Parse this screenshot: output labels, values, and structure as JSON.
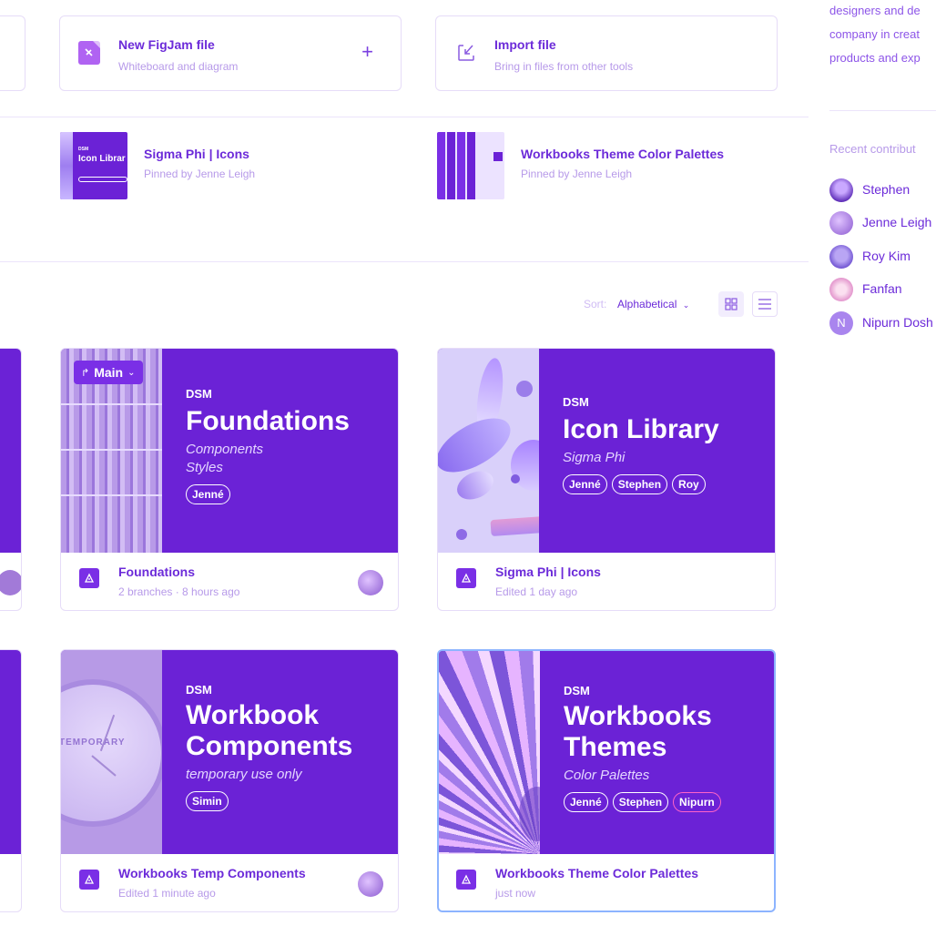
{
  "create": {
    "figjam": {
      "title": "New FigJam file",
      "subtitle": "Whiteboard and diagram",
      "action": "+"
    },
    "import": {
      "title": "Import file",
      "subtitle": "Bring in files from other tools"
    }
  },
  "pinned": [
    {
      "title": "Sigma Phi | Icons",
      "subtitle": "Pinned by Jenne Leigh",
      "thumb_label": "Icon Librar"
    },
    {
      "title": "Workbooks Theme Color Palettes",
      "subtitle": "Pinned by Jenne Leigh"
    }
  ],
  "sort": {
    "label": "Sort:",
    "value": "Alphabetical"
  },
  "files": [
    {
      "branch_label": "Main",
      "eyebrow": "DSM",
      "title_lines": [
        "Foundations"
      ],
      "subtitle_lines": [
        "Components",
        "Styles"
      ],
      "chips": [
        "Jenné"
      ],
      "name": "Foundations",
      "meta": "2 branches · 8 hours ago"
    },
    {
      "eyebrow": "DSM",
      "title_lines": [
        "Icon Library"
      ],
      "subtitle_lines": [
        "Sigma Phi"
      ],
      "chips": [
        "Jenné",
        "Stephen",
        "Roy"
      ],
      "name": "Sigma Phi | Icons",
      "meta": "Edited 1 day ago"
    },
    {
      "eyebrow": "DSM",
      "title_lines": [
        "Workbook",
        "Components"
      ],
      "subtitle_lines": [
        "temporary use only"
      ],
      "chips": [
        "Simin"
      ],
      "name": "Workbooks Temp Components",
      "meta": "Edited 1 minute ago",
      "cover_text": "TEMPORARY"
    },
    {
      "eyebrow": "DSM",
      "title_lines": [
        "Workbooks",
        "Themes"
      ],
      "subtitle_lines": [
        "Color Palettes"
      ],
      "chips": [
        "Jenné",
        "Stephen",
        "Nipurn"
      ],
      "name": "Workbooks Theme Color Palettes",
      "meta": "just now"
    }
  ],
  "sidebar": {
    "description_lines": [
      "designers and de",
      "company in creat",
      "products and exp"
    ],
    "contributors_heading": "Recent contribut",
    "contributors": [
      {
        "name": "Stephen"
      },
      {
        "name": "Jenne Leigh"
      },
      {
        "name": "Roy Kim"
      },
      {
        "name": "Fanfan"
      },
      {
        "name": "Nipurn Dosh",
        "initial": "N"
      }
    ]
  },
  "colors": {
    "accent": "#6c2bd9",
    "cover": "#6b22d6",
    "muted": "#b79ae9",
    "selection": "#8db4ff"
  }
}
